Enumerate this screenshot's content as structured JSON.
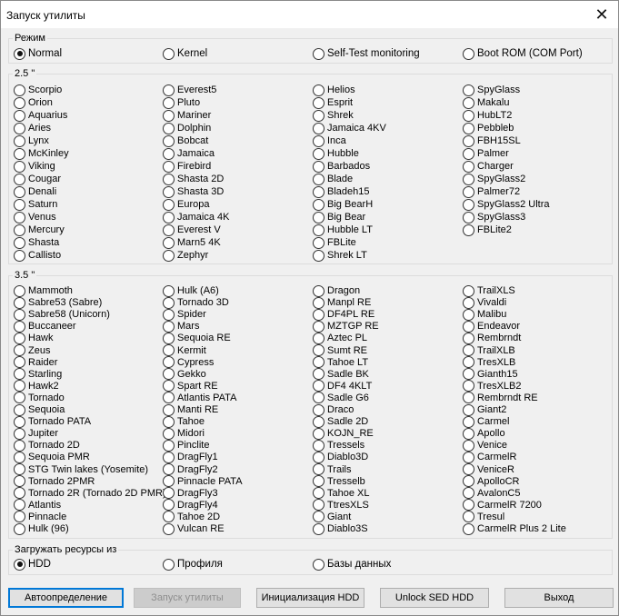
{
  "window": {
    "title": "Запуск утилиты",
    "close_glyph": "✕"
  },
  "mode_group": {
    "label": "Режим",
    "options": [
      "Normal",
      "Kernel",
      "Self-Test monitoring",
      "Boot ROM (COM Port)"
    ],
    "selected": "Normal"
  },
  "group_25": {
    "label": "2.5 \"",
    "columns": [
      [
        "Scorpio",
        "Orion",
        "Aquarius",
        "Aries",
        "Lynx",
        "McKinley",
        "Viking",
        "Cougar",
        "Denali",
        "Saturn",
        "Venus",
        "Mercury",
        "Shasta",
        "Callisto"
      ],
      [
        "Everest5",
        "Pluto",
        "Mariner",
        "Dolphin",
        "Bobcat",
        "Jamaica",
        "Firebird",
        "Shasta 2D",
        "Shasta 3D",
        "Europa",
        "Jamaica 4K",
        "Everest V",
        "Marn5 4K",
        "Zephyr"
      ],
      [
        "Helios",
        "Esprit",
        "Shrek",
        "Jamaica 4KV",
        "Inca",
        "Hubble",
        "Barbados",
        "Blade",
        "Bladeh15",
        "Big BearH",
        "Big Bear",
        "Hubble LT",
        "FBLite",
        "Shrek LT"
      ],
      [
        "SpyGlass",
        "Makalu",
        "HubLT2",
        "Pebbleb",
        "FBH15SL",
        "Palmer",
        "Charger",
        "SpyGlass2",
        "Palmer72",
        "SpyGlass2 Ultra",
        "SpyGlass3",
        "FBLite2"
      ]
    ]
  },
  "group_35": {
    "label": "3.5 \"",
    "columns": [
      [
        "Mammoth",
        "Sabre53 (Sabre)",
        "Sabre58 (Unicorn)",
        "Buccaneer",
        "Hawk",
        "Zeus",
        "Raider",
        "Starling",
        "Hawk2",
        "Tornado",
        "Sequoia",
        "Tornado PATA",
        "Jupiter",
        "Tornado 2D",
        "Sequoia PMR",
        "STG Twin lakes (Yosemite)",
        "Tornado 2PMR",
        "Tornado 2R (Tornado 2D PMR)",
        "Atlantis",
        "Pinnacle",
        "Hulk (96)"
      ],
      [
        "Hulk (A6)",
        "Tornado 3D",
        "Spider",
        "Mars",
        "Sequoia RE",
        "Kermit",
        "Cypress",
        "Gekko",
        "Spart RE",
        "Atlantis PATA",
        "Manti RE",
        "Tahoe",
        "Midori",
        "Pinclite",
        "DragFly1",
        "DragFly2",
        "Pinnacle PATA",
        "DragFly3",
        "DragFly4",
        "Tahoe 2D",
        "Vulcan RE"
      ],
      [
        "Dragon",
        "Manpl RE",
        "DF4PL RE",
        "MZTGP RE",
        "Aztec PL",
        "Sumt RE",
        "Tahoe LT",
        "Sadle BK",
        "DF4 4KLT",
        "Sadle G6",
        "Draco",
        "Sadle 2D",
        "KOJN_RE",
        "Tressels",
        "Diablo3D",
        "Trails",
        "Tresselb",
        "Tahoe XL",
        "TtresXLS",
        "Giant",
        "Diablo3S"
      ],
      [
        "TrailXLS",
        "Vivaldi",
        "Malibu",
        "Endeavor",
        "Rembrndt",
        "TrailXLB",
        "TresXLB",
        "Gianth15",
        "TresXLB2",
        "Rembrndt RE",
        "Giant2",
        "Carmel",
        "Apollo",
        "Venice",
        "CarmelR",
        "VeniceR",
        "ApolloCR",
        "AvalonC5",
        "CarmelR 7200",
        "Tresul",
        "CarmelR Plus 2 Lite"
      ]
    ]
  },
  "resources_group": {
    "label": "Загружать ресурсы из",
    "options": [
      "HDD",
      "Профиля",
      "Базы данных"
    ],
    "selected": "HDD"
  },
  "buttons": {
    "autodetect": "Автоопределение",
    "launch": "Запуск утилиты",
    "init_hdd": "Инициализация HDD",
    "unlock": "Unlock SED HDD",
    "exit": "Выход"
  }
}
